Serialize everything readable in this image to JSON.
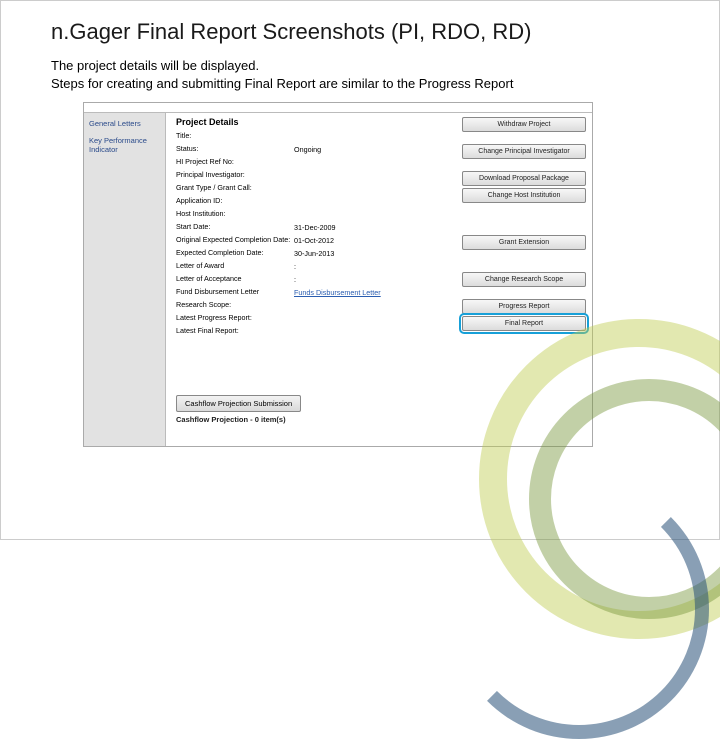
{
  "title": "n.Gager Final Report Screenshots (PI, RDO, RD)",
  "body_line1": "The project details will be displayed.",
  "body_line2": "Steps for creating and submitting Final Report are similar to the Progress Report",
  "sidebar": {
    "items": [
      {
        "label": "General Letters"
      },
      {
        "label": "Key Performance Indicator"
      }
    ]
  },
  "details": {
    "section_title": "Project Details",
    "rows": [
      {
        "label": "Title:",
        "value": ""
      },
      {
        "label": "Status:",
        "value": "Ongoing"
      },
      {
        "label": "HI Project Ref No:",
        "value": ""
      },
      {
        "label": "Principal Investigator:",
        "value": ""
      },
      {
        "label": "Grant Type / Grant Call:",
        "value": ""
      },
      {
        "label": "Application ID:",
        "value": ""
      },
      {
        "label": "Host Institution:",
        "value": ""
      },
      {
        "label": "Start Date:",
        "value": "31-Dec-2009"
      },
      {
        "label": "Original Expected Completion Date:",
        "value": "01-Oct-2012"
      },
      {
        "label": "Expected Completion Date:",
        "value": "30-Jun-2013"
      },
      {
        "label": "Letter of Award",
        "value": ":"
      },
      {
        "label": "Letter of Acceptance",
        "value": ":"
      },
      {
        "label": "Fund Disbursement Letter",
        "value": "Funds Disbursement Letter",
        "link": true
      },
      {
        "label": "Research Scope:",
        "value": ""
      },
      {
        "label": "Latest Progress Report:",
        "value": ""
      },
      {
        "label": "Latest Final Report:",
        "value": ""
      }
    ]
  },
  "actions": {
    "buttons": [
      {
        "label": "Withdraw Project"
      },
      {
        "label": "",
        "spacer": true
      },
      {
        "label": "Change Principal Investigator"
      },
      {
        "label": "",
        "spacer": true
      },
      {
        "label": "Download Proposal Package"
      },
      {
        "label": "Change Host Institution"
      },
      {
        "label": "",
        "spacer": true
      },
      {
        "label": "",
        "spacer": true
      },
      {
        "label": "",
        "spacer": true
      },
      {
        "label": "Grant Extension"
      },
      {
        "label": "",
        "spacer": true
      },
      {
        "label": "",
        "spacer": true
      },
      {
        "label": "Change Research Scope"
      },
      {
        "label": "",
        "spacer": true
      },
      {
        "label": "Progress Report"
      },
      {
        "label": "Final Report",
        "highlight": true
      }
    ]
  },
  "bottom": {
    "button": "Cashflow Projection Submission",
    "text": "Cashflow Projection - 0 item(s)"
  }
}
